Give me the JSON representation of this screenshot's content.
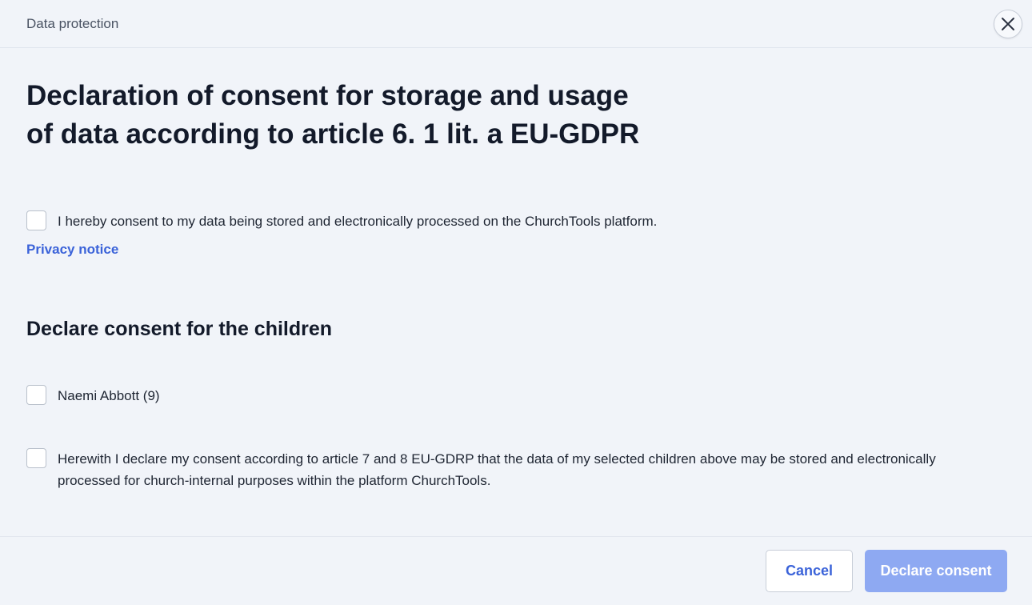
{
  "dialog": {
    "header_title": "Data protection"
  },
  "main": {
    "title_line1": "Declaration of consent for storage and usage",
    "title_line2": "of data according to article 6. 1 lit. a EU-GDPR",
    "consent_text": "I hereby consent to my data being stored and electronically processed on the ChurchTools platform.",
    "privacy_link": "Privacy notice",
    "children_section_title": "Declare consent for the children",
    "children": [
      {
        "label": "Naemi Abbott (9)"
      }
    ],
    "children_consent_text": "Herewith I declare my consent according to article 7 and 8 EU-GDRP that the data of my selected children above may be stored and electronically processed for church-internal purposes within the platform ChurchTools."
  },
  "footer": {
    "cancel_label": "Cancel",
    "declare_label": "Declare consent"
  },
  "colors": {
    "accent": "#3b63d9",
    "primary_button_disabled": "#8ea9f2",
    "background": "#f1f4f9"
  },
  "icons": {
    "close": "close-icon"
  }
}
